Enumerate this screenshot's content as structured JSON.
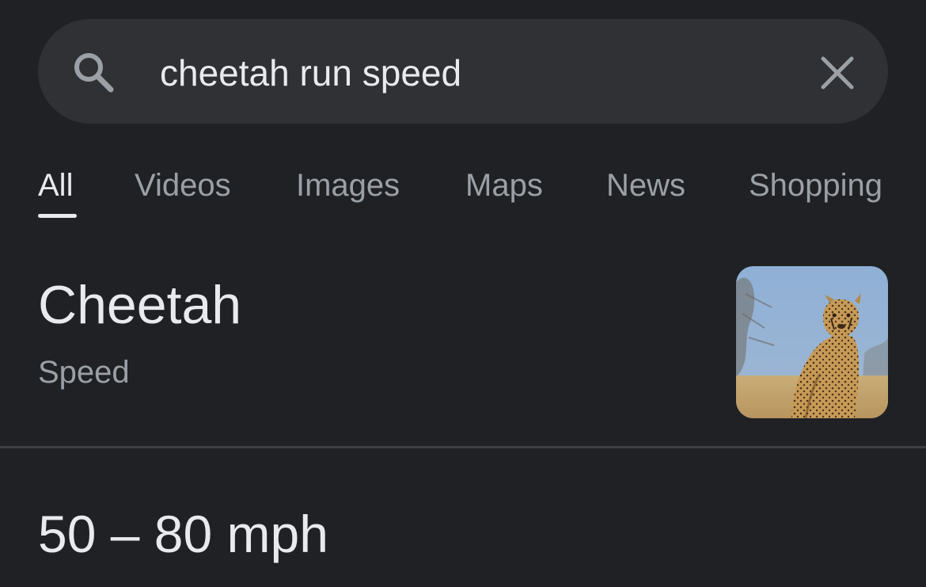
{
  "search": {
    "query": "cheetah run speed",
    "search_icon": "search-icon",
    "clear_icon": "close-icon"
  },
  "tabs": [
    {
      "label": "All",
      "active": true
    },
    {
      "label": "Videos",
      "active": false
    },
    {
      "label": "Images",
      "active": false
    },
    {
      "label": "Maps",
      "active": false
    },
    {
      "label": "News",
      "active": false
    },
    {
      "label": "Shopping",
      "active": false
    }
  ],
  "result": {
    "title": "Cheetah",
    "subtitle": "Speed",
    "thumbnail_icon": "cheetah-thumbnail",
    "answer": "50 – 80 mph"
  },
  "colors": {
    "background": "#202124",
    "search_bar": "#303134",
    "primary_text": "#e8eaed",
    "secondary_text": "#9aa0a6",
    "divider": "#3c4043"
  }
}
